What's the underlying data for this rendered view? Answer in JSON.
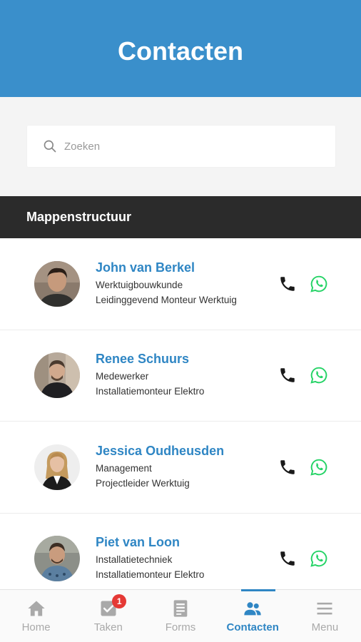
{
  "header": {
    "title": "Contacten"
  },
  "search": {
    "placeholder": "Zoeken"
  },
  "section": {
    "title": "Mappenstructuur"
  },
  "contacts": [
    {
      "name": "John van Berkel",
      "department": "Werktuigbouwkunde",
      "role": "Leidinggevend Monteur Werktuig"
    },
    {
      "name": "Renee Schuurs",
      "department": "Medewerker",
      "role": "Installatiemonteur Elektro"
    },
    {
      "name": "Jessica Oudheusden",
      "department": "Management",
      "role": "Projectleider Werktuig"
    },
    {
      "name": "Piet van Loon",
      "department": "Installatietechniek",
      "role": "Installatiemonteur Elektro"
    }
  ],
  "tabs": [
    {
      "label": "Home",
      "icon": "home-icon"
    },
    {
      "label": "Taken",
      "icon": "tasks-icon",
      "badge": "1"
    },
    {
      "label": "Forms",
      "icon": "forms-icon"
    },
    {
      "label": "Contacten",
      "icon": "contacts-icon",
      "active": true
    },
    {
      "label": "Menu",
      "icon": "menu-icon"
    }
  ],
  "colors": {
    "primary": "#3a8fcb",
    "accent": "#2f86c4",
    "whatsapp": "#25d366",
    "badge": "#e53935",
    "section_bar": "#2b2b2b"
  }
}
